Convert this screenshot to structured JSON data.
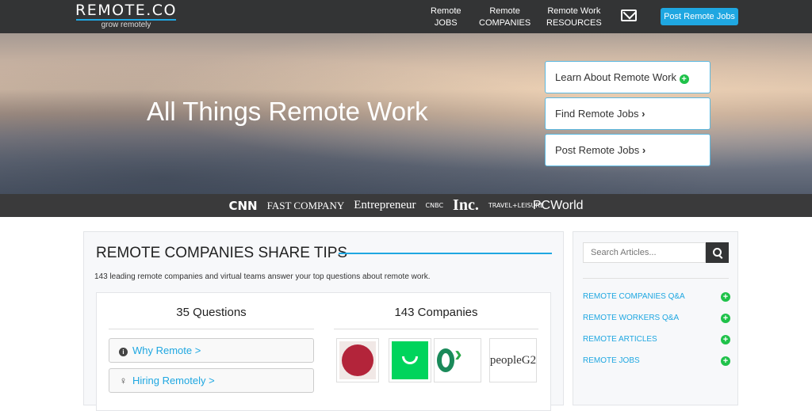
{
  "nav": {
    "logo": "REMOTE.CO",
    "tagline": "grow remotely",
    "items": [
      {
        "l1": "Remote",
        "l2": "JOBS"
      },
      {
        "l1": "Remote",
        "l2": "COMPANIES"
      },
      {
        "l1": "Remote Work",
        "l2": "RESOURCES"
      }
    ],
    "post_button": "Post Remote Jobs"
  },
  "hero": {
    "title": "All Things Remote Work",
    "buttons": [
      "Learn About Remote Work",
      "Find Remote Jobs",
      "Post Remote Jobs"
    ]
  },
  "press": [
    "CNN",
    "FAST COMPANY",
    "Entrepreneur",
    "CNBC",
    "Inc.",
    "TRAVEL+LEISURE",
    "PCWorld"
  ],
  "main": {
    "title": "REMOTE COMPANIES SHARE TIPS",
    "subtitle": "143 leading remote companies and virtual teams answer your top questions about remote work.",
    "questions_heading": "35 Questions",
    "companies_heading": "143 Companies",
    "questions": [
      "Why Remote >",
      "Hiring Remotely >"
    ],
    "logos": [
      {
        "name": "cb",
        "color": "#b3243a"
      },
      {
        "name": "smile",
        "color": "#00d45c"
      },
      {
        "name": "chat",
        "color": "#1a8a5a"
      },
      {
        "name": "peopleG2",
        "color": "#333"
      }
    ]
  },
  "sidebar": {
    "search_placeholder": "Search Articles...",
    "links": [
      "REMOTE COMPANIES Q&A",
      "REMOTE WORKERS Q&A",
      "REMOTE ARTICLES",
      "REMOTE JOBS"
    ]
  },
  "colors": {
    "accent": "#1fa7e1",
    "green": "#1fc24a",
    "nav_bg": "#333435"
  }
}
